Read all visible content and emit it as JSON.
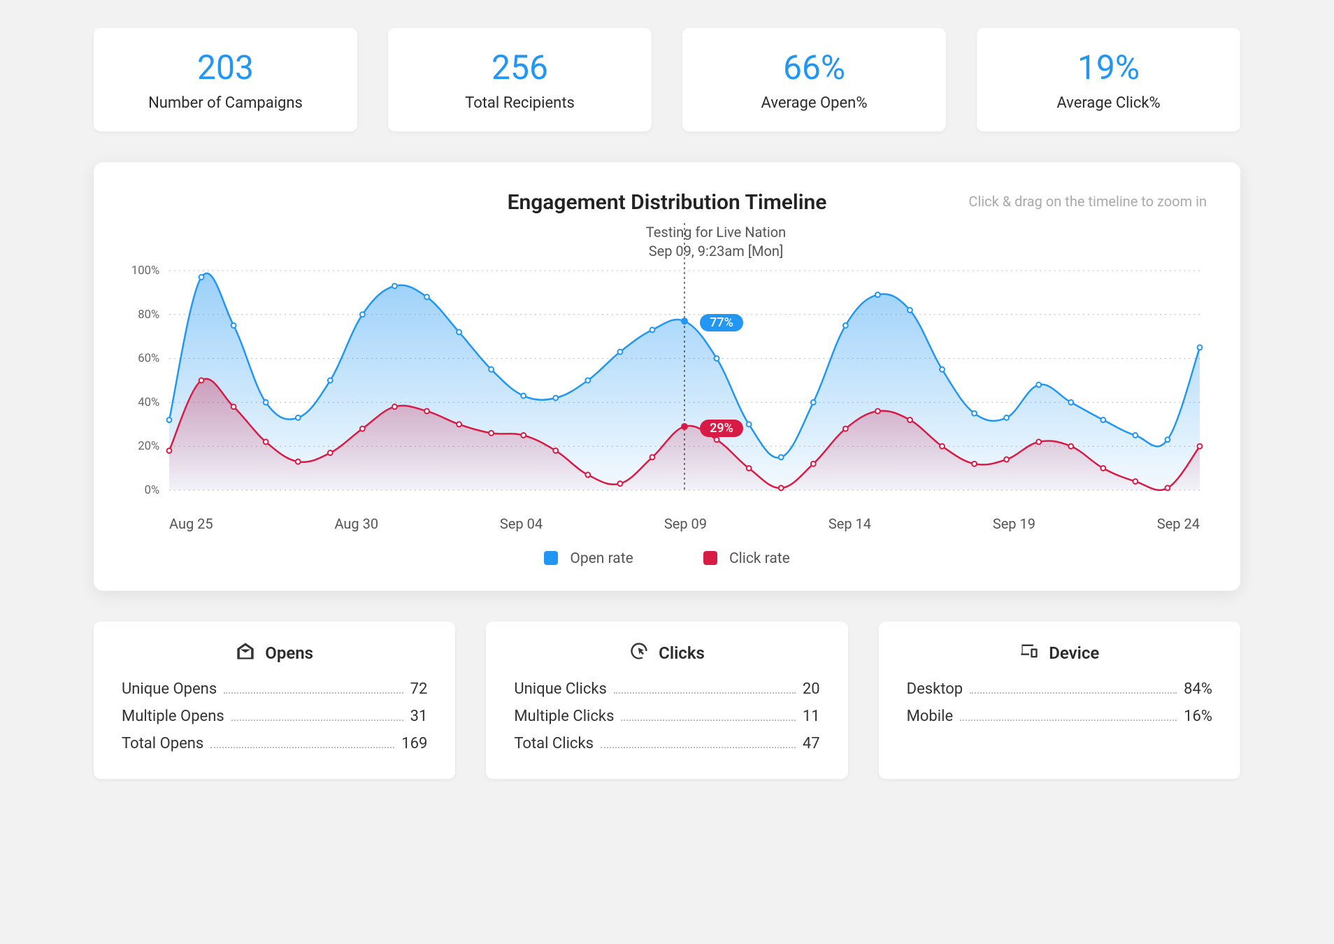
{
  "kpis": [
    {
      "value": "203",
      "label": "Number of Campaigns"
    },
    {
      "value": "256",
      "label": "Total Recipients"
    },
    {
      "value": "66%",
      "label": "Average Open%"
    },
    {
      "value": "19%",
      "label": "Average Click%"
    }
  ],
  "chart": {
    "title": "Engagement Distribution Timeline",
    "hint": "Click & drag on the timeline to zoom in",
    "tooltip_line1": "Testing for Live Nation",
    "tooltip_line2": "Sep 09, 9:23am [Mon]",
    "focus_open": "77%",
    "focus_click": "29%",
    "legend": {
      "open": "Open rate",
      "click": "Click rate"
    },
    "colors": {
      "open": "#2196f3",
      "open_area": "rgba(33,150,243,0.25)",
      "click": "#d81b44",
      "click_area": "rgba(216,27,68,0.18)"
    }
  },
  "chart_data": {
    "type": "area",
    "title": "Engagement Distribution Timeline",
    "xlabel": "",
    "ylabel": "",
    "ylim": [
      0,
      100
    ],
    "y_ticks": [
      "0%",
      "20%",
      "40%",
      "60%",
      "80%",
      "100%"
    ],
    "x_tick_labels": [
      "Aug 25",
      "Aug 30",
      "Sep 04",
      "Sep 09",
      "Sep 14",
      "Sep 19",
      "Sep 24"
    ],
    "x": [
      "Aug 24",
      "Aug 25",
      "Aug 26",
      "Aug 27",
      "Aug 28",
      "Aug 29",
      "Aug 30",
      "Aug 31",
      "Sep 01",
      "Sep 02",
      "Sep 03",
      "Sep 04",
      "Sep 05",
      "Sep 06",
      "Sep 07",
      "Sep 08",
      "Sep 09",
      "Sep 10",
      "Sep 11",
      "Sep 12",
      "Sep 13",
      "Sep 14",
      "Sep 15",
      "Sep 16",
      "Sep 17",
      "Sep 18",
      "Sep 19",
      "Sep 20",
      "Sep 21",
      "Sep 22",
      "Sep 23",
      "Sep 24",
      "Sep 25"
    ],
    "series": [
      {
        "name": "Open rate",
        "color": "#2196f3",
        "values": [
          32,
          97,
          75,
          40,
          33,
          50,
          80,
          93,
          88,
          72,
          55,
          43,
          42,
          50,
          63,
          73,
          77,
          60,
          30,
          15,
          40,
          75,
          89,
          82,
          55,
          35,
          33,
          48,
          40,
          32,
          25,
          23,
          65
        ]
      },
      {
        "name": "Click rate",
        "color": "#d81b44",
        "values": [
          18,
          50,
          38,
          22,
          13,
          17,
          28,
          38,
          36,
          30,
          26,
          25,
          18,
          7,
          3,
          15,
          29,
          23,
          10,
          1,
          12,
          28,
          36,
          32,
          20,
          12,
          14,
          22,
          20,
          10,
          4,
          1,
          20
        ]
      }
    ],
    "focus_x": "Sep 09",
    "focus_values": {
      "Open rate": 77,
      "Click rate": 29
    }
  },
  "opens": {
    "title": "Opens",
    "rows": [
      {
        "k": "Unique Opens",
        "v": "72"
      },
      {
        "k": "Multiple Opens",
        "v": "31"
      },
      {
        "k": "Total Opens",
        "v": "169"
      }
    ]
  },
  "clicks": {
    "title": "Clicks",
    "rows": [
      {
        "k": "Unique Clicks",
        "v": "20"
      },
      {
        "k": "Multiple Clicks",
        "v": "11"
      },
      {
        "k": "Total Clicks",
        "v": "47"
      }
    ]
  },
  "device": {
    "title": "Device",
    "rows": [
      {
        "k": "Desktop",
        "v": "84%"
      },
      {
        "k": "Mobile",
        "v": "16%"
      }
    ]
  }
}
